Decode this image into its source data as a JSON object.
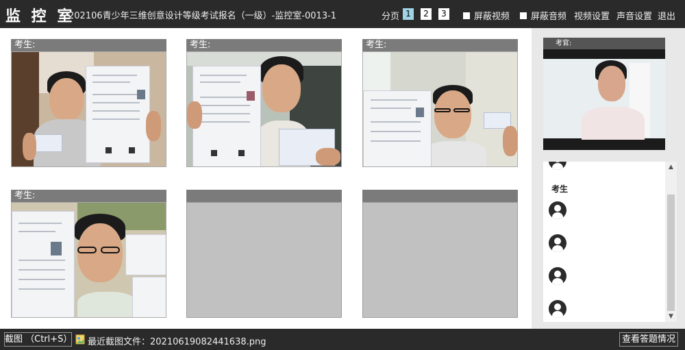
{
  "topbar": {
    "logo": "监 控 室",
    "title": "202106青少年三维创意设计等级考试报名（一级）-监控室-0013-1",
    "pager_label": "分页",
    "pages": [
      "1",
      "2",
      "3"
    ],
    "active_page": "1",
    "mute_video_label": "屏蔽视频",
    "mute_audio_label": "屏蔽音频",
    "video_settings_label": "视频设置",
    "audio_settings_label": "声音设置",
    "exit_label": "退出"
  },
  "tiles": [
    {
      "label": "考生:"
    },
    {
      "label": "考生:"
    },
    {
      "label": "考生:"
    },
    {
      "label": "考生:"
    },
    {
      "label": ""
    },
    {
      "label": ""
    }
  ],
  "examiner": {
    "label": "考官:"
  },
  "roster": {
    "section_label": "考生",
    "icons": [
      "user-avatar-icon",
      "user-avatar-icon",
      "user-avatar-icon",
      "user-avatar-icon",
      "user-avatar-icon",
      "user-avatar-icon"
    ]
  },
  "bottombar": {
    "screenshot_label": "截图 （Ctrl+S）",
    "recent_prefix": "最近截图文件：",
    "recent_file": "20210619082441638.png",
    "answers_label": "查看答题情况"
  },
  "colors": {
    "bar_bg": "#2a2a2a",
    "tile_header": "#7b7b7b",
    "empty_tile": "#c1c1c1",
    "active_page": "#9fd3e6"
  }
}
